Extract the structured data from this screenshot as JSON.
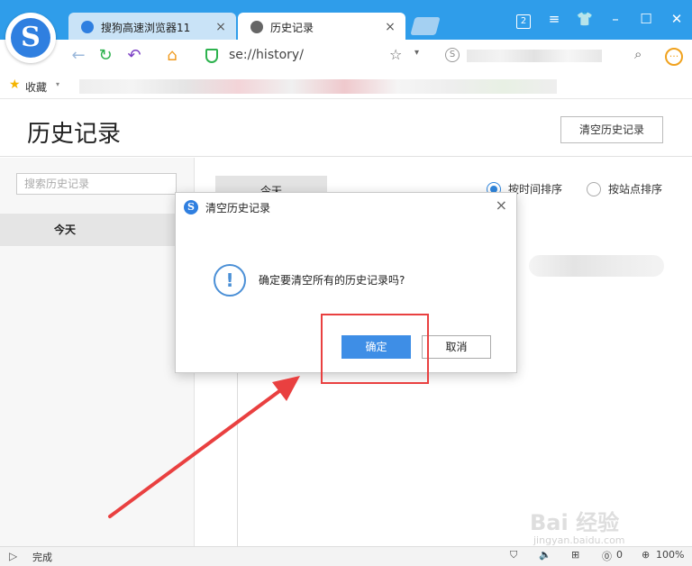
{
  "tabs": [
    {
      "label": "搜狗高速浏览器11",
      "close": "×"
    },
    {
      "label": "历史记录",
      "close": "×"
    }
  ],
  "window_controls": {
    "badge": "2"
  },
  "address_bar": {
    "url": "se://history/"
  },
  "bookmarks": {
    "label": "收藏"
  },
  "page": {
    "title": "历史记录",
    "clear_button": "清空历史记录",
    "search_placeholder": "搜索历史记录",
    "sidebar_today": "今天",
    "main_today": "今天",
    "sort_by_time": "按时间排序",
    "sort_by_site": "按站点排序"
  },
  "dialog": {
    "title": "清空历史记录",
    "message": "确定要清空所有的历史记录吗?",
    "ok": "确定",
    "cancel": "取消",
    "close": "×"
  },
  "status_bar": {
    "text": "完成",
    "zoom": "100%",
    "count": "0"
  },
  "watermark": {
    "main": "Bai 经验",
    "sub": "jingyan.baidu.com"
  },
  "colors": {
    "accent": "#2f9dea",
    "primary_button": "#3e8ee6",
    "annotation": "#e94040"
  }
}
